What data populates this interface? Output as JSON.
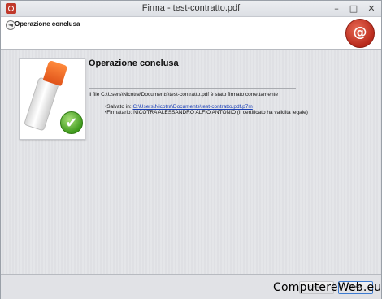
{
  "window": {
    "title": "Firma - test-contratto.pdf",
    "controls": {
      "minimize": "–",
      "maximize": "□",
      "close": "✕"
    }
  },
  "header": {
    "back_icon": "◄",
    "title": "Operazione conclusa",
    "logo_glyph": "@"
  },
  "main": {
    "title": "Operazione conclusa",
    "message": "Il file C:\\Users\\Nicotra\\Documents\\test-contratto.pdf è stato firmato correttamente",
    "saved_label": "•Salvato in: ",
    "saved_path": "C:\\Users\\Nicotra\\Documents\\test-contratto.pdf.p7m",
    "signer_text": "•Firmatario: NICOTRA ALESSANDRO ALFIO ANTONIO (il certificato ha validità legale)",
    "check_glyph": "✔"
  },
  "footer": {
    "back_label": "< Back",
    "finish_label": "Finish"
  },
  "watermark": "ComputereWeb.eu",
  "colors": {
    "accent_logo": "#b82a1c",
    "check_green": "#3f9a1c",
    "link": "#1a3fb5"
  }
}
